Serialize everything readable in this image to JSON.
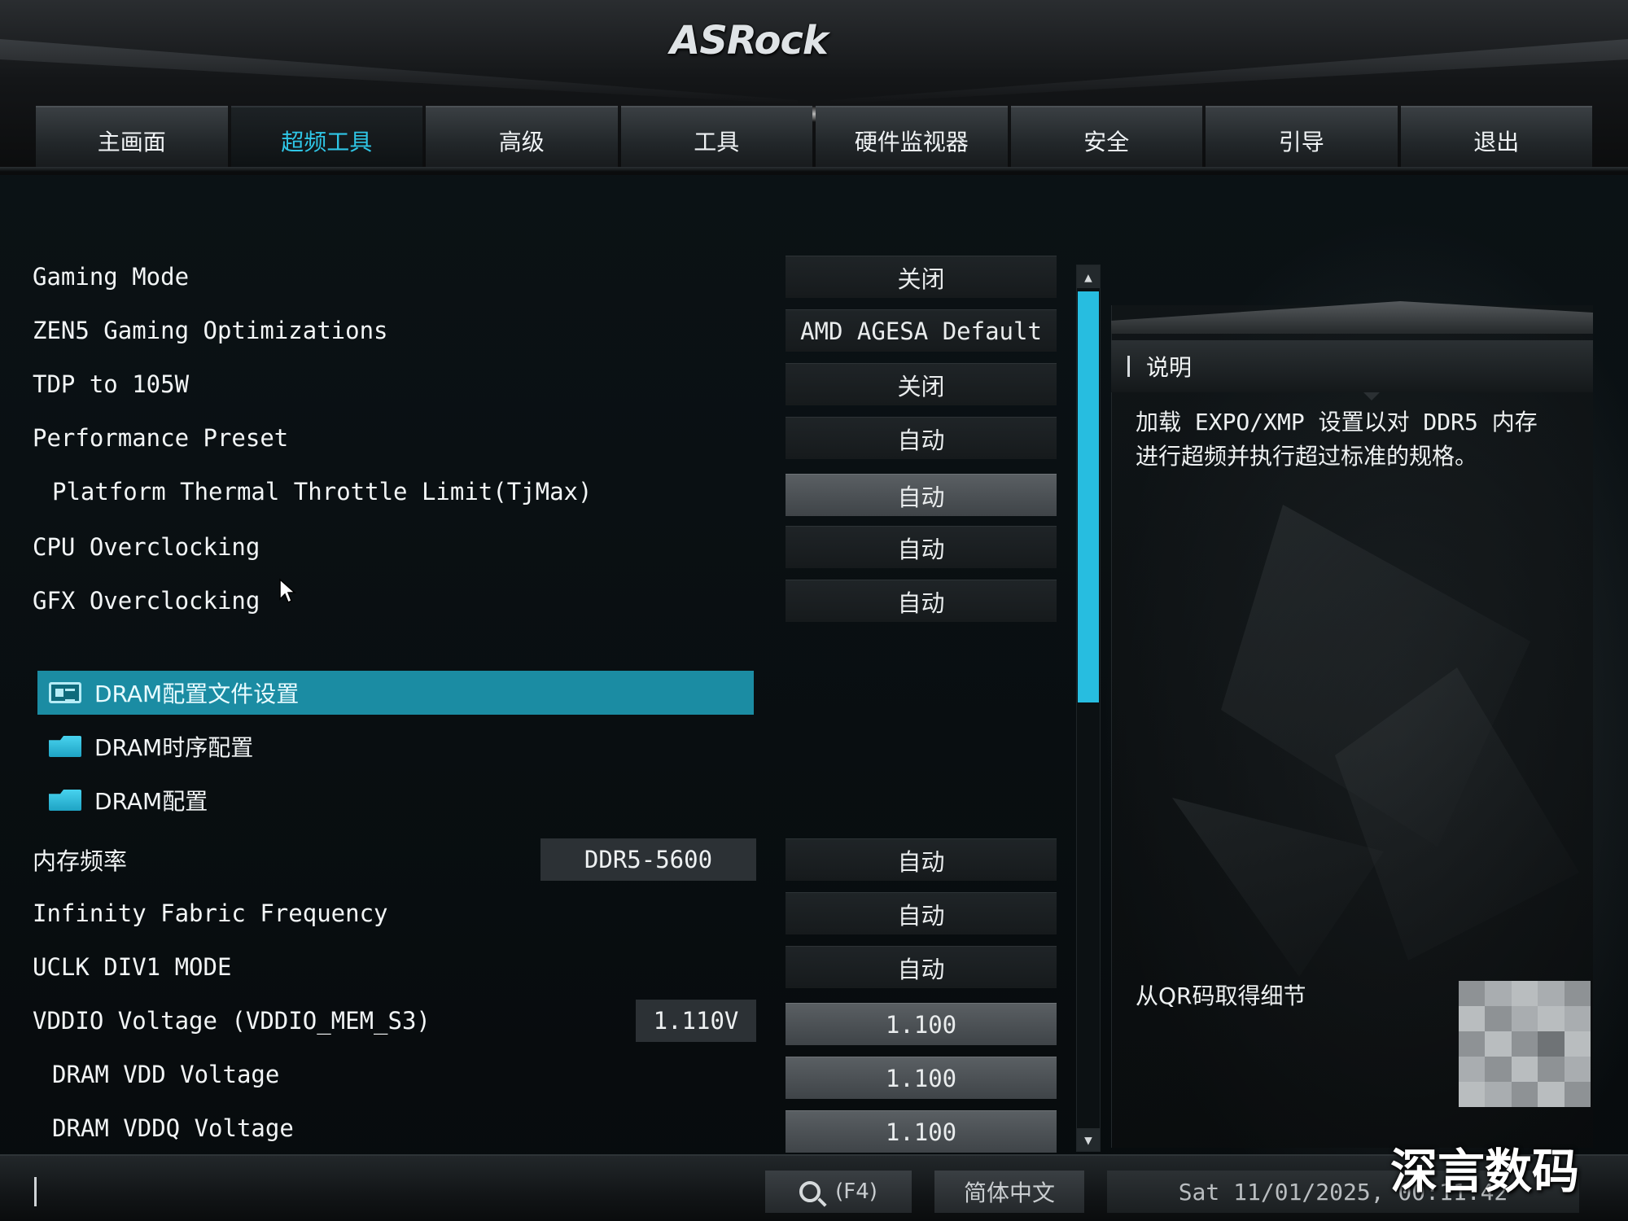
{
  "brand": {
    "logo": "ASRock"
  },
  "tabs": [
    {
      "label": "主画面",
      "active": false
    },
    {
      "label": "超频工具",
      "active": true
    },
    {
      "label": "高级",
      "active": false
    },
    {
      "label": "工具",
      "active": false
    },
    {
      "label": "硬件监视器",
      "active": false
    },
    {
      "label": "安全",
      "active": false
    },
    {
      "label": "引导",
      "active": false
    },
    {
      "label": "退出",
      "active": false
    }
  ],
  "settings": {
    "gaming_mode": {
      "label": "Gaming Mode",
      "value": "关闭"
    },
    "zen5": {
      "label": "ZEN5 Gaming Optimizations",
      "value": "AMD AGESA Default"
    },
    "tdp": {
      "label": "TDP to 105W",
      "value": "关闭"
    },
    "perf_preset": {
      "label": "Performance Preset",
      "value": "自动"
    },
    "tjmax": {
      "label": "Platform Thermal Throttle Limit(TjMax)",
      "value": "自动"
    },
    "cpu_oc": {
      "label": "CPU Overclocking",
      "value": "自动"
    },
    "gfx_oc": {
      "label": "GFX Overclocking",
      "value": "自动"
    },
    "mem_freq": {
      "label": "内存频率",
      "current": "DDR5-5600",
      "value": "自动"
    },
    "if_freq": {
      "label": "Infinity Fabric Frequency",
      "value": "自动"
    },
    "uclk": {
      "label": "UCLK DIV1 MODE",
      "value": "自动"
    },
    "vddio": {
      "label": "VDDIO Voltage (VDDIO_MEM_S3)",
      "current": "1.110V",
      "value": "1.100"
    },
    "dram_vdd": {
      "label": "DRAM VDD Voltage",
      "value": "1.100"
    },
    "dram_vddq": {
      "label": "DRAM VDDQ Voltage",
      "value": "1.100"
    }
  },
  "menus": {
    "dram_profile": "DRAM配置文件设置",
    "dram_timing": "DRAM时序配置",
    "dram_config": "DRAM配置"
  },
  "description": {
    "title": "说明",
    "text": "加载 EXPO/XMP 设置以对 DDR5 内存进行超频并执行超过标准的规格。",
    "qr_label": "从QR码取得细节"
  },
  "footer": {
    "search": "(F4)",
    "language": "简体中文",
    "datetime": "Sat 11/01/2025, 00:11:42"
  },
  "watermark": "深言数码",
  "colors": {
    "accent": "#27bde0",
    "selected_row": "#1b8ca3",
    "active_tab": "#2fc6e6"
  }
}
